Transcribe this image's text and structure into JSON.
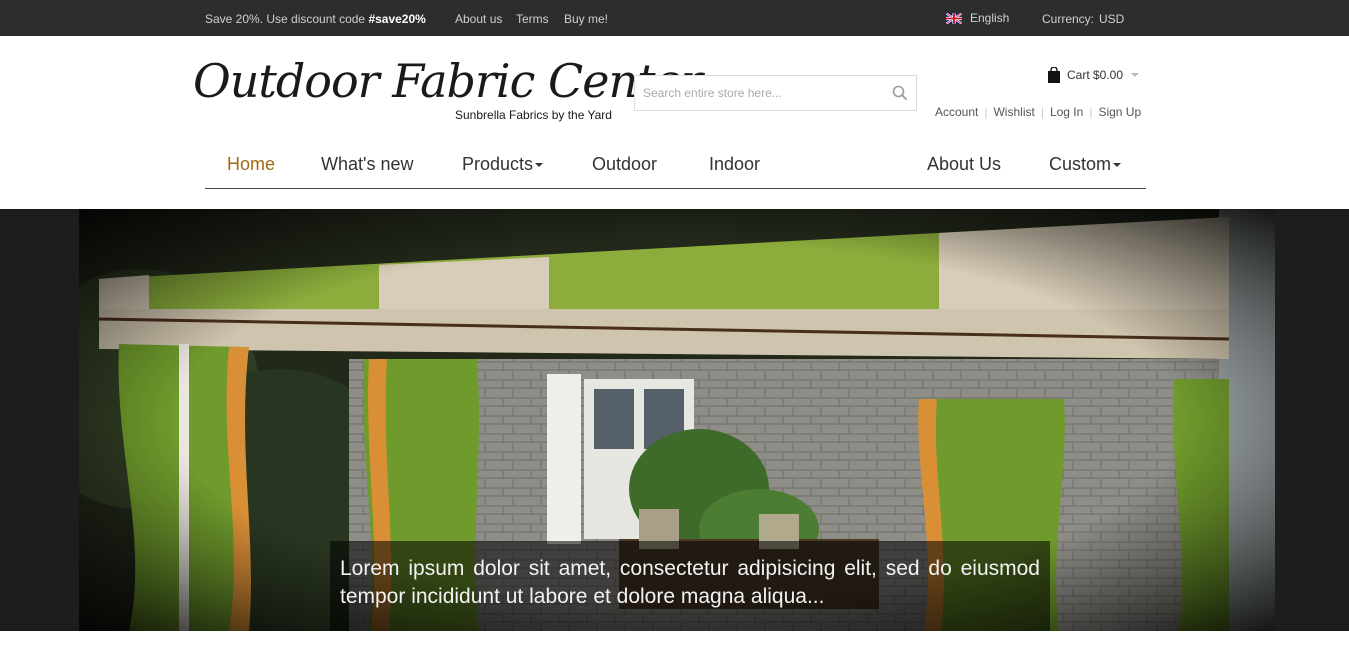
{
  "topbar": {
    "promo_text": "Save 20%. Use discount code ",
    "promo_code": "#save20%",
    "links": [
      "About us",
      "Terms",
      "Buy me!"
    ],
    "language": "English",
    "currency_label": "Currency:",
    "currency_value": "USD"
  },
  "header": {
    "logo_title": "Outdoor Fabric Center",
    "logo_tagline": "Sunbrella Fabrics by the Yard",
    "search_placeholder": "Search entire store here...",
    "cart_label": "Cart $0.00",
    "account_links": [
      "Account",
      "Wishlist",
      "Log In",
      "Sign Up"
    ]
  },
  "nav": {
    "items": [
      "Home",
      "What's new",
      "Products",
      "Outdoor",
      "Indoor",
      "About Us",
      "Custom"
    ],
    "active": "Home"
  },
  "hero": {
    "caption": "Lorem ipsum dolor sit amet, consectetur adipisicing elit, sed do eiusmod tempor incididunt ut labore et dolore magna aliqua..."
  },
  "colors": {
    "topbar_bg": "#2d2d2d",
    "nav_active": "#a06a14",
    "hero_bg": "#1d1d1d",
    "awning_green": "#8cad3c",
    "awning_cream": "#d8cdb8"
  },
  "icons": [
    "flag-uk-icon",
    "search-icon",
    "shopping-bag-icon",
    "caret-down-icon"
  ]
}
